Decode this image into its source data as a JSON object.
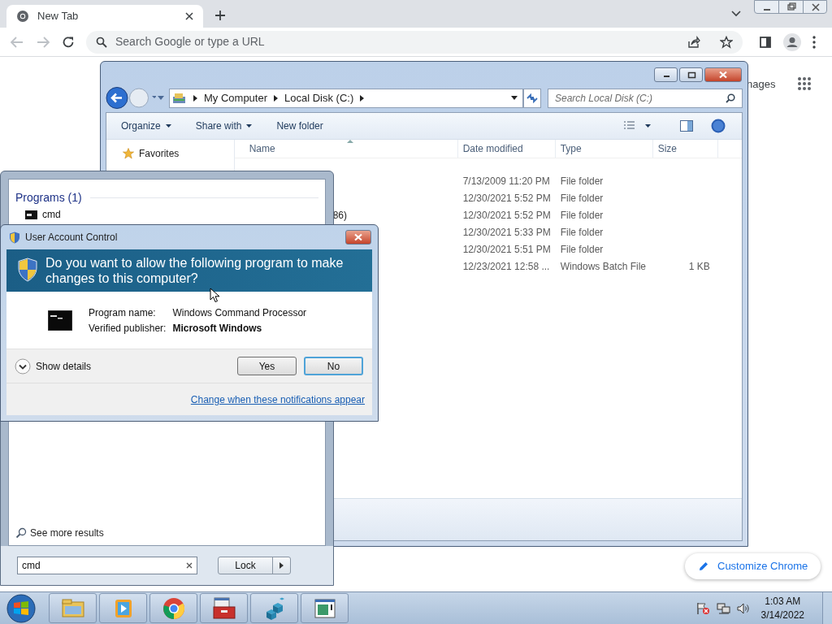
{
  "browser": {
    "tab": {
      "title": "New Tab",
      "selected": true
    },
    "address_placeholder": "Search Google or type a URL",
    "page": {
      "link_fragment": "nages",
      "customize_button": "Customize Chrome"
    }
  },
  "explorer": {
    "breadcrumb": [
      "My Computer",
      "Local Disk (C:)"
    ],
    "search_placeholder": "Search Local Disk (C:)",
    "toolbar": [
      {
        "label": "Organize",
        "dropdown": true
      },
      {
        "label": "Share with",
        "dropdown": true
      },
      {
        "label": "New folder",
        "dropdown": false
      }
    ],
    "nav": [
      {
        "label": "Favorites"
      }
    ],
    "columns": [
      "Name",
      "Date modified",
      "Type",
      "Size"
    ],
    "rows": [
      {
        "date": "7/13/2009 11:20 PM",
        "type": "File folder"
      },
      {
        "date": "12/30/2021 5:52 PM",
        "type": "File folder"
      },
      {
        "name": "86)",
        "date": "12/30/2021 5:52 PM",
        "type": "File folder"
      },
      {
        "date": "12/30/2021 5:33 PM",
        "type": "File folder"
      },
      {
        "date": "12/30/2021 5:51 PM",
        "type": "File folder"
      },
      {
        "date": "12/23/2021 12:58 ...",
        "type": "Windows Batch File",
        "size": "1 KB"
      }
    ]
  },
  "start_menu": {
    "section_title": "Programs (1)",
    "results": [
      {
        "label": "cmd"
      }
    ],
    "see_more": "See more results",
    "search_value": "cmd",
    "power_button": "Lock"
  },
  "uac": {
    "title": "User Account Control",
    "question": "Do you want to allow the following program to make changes to this computer?",
    "details": [
      {
        "label": "Program name:",
        "value": "Windows Command Processor",
        "bold": false
      },
      {
        "label": "Verified publisher:",
        "value": "Microsoft Windows",
        "bold": true
      }
    ],
    "show_details": "Show details",
    "buttons": [
      {
        "label": "Yes",
        "selected": false
      },
      {
        "label": "No",
        "selected": true
      }
    ],
    "link": "Change when these notifications appear"
  },
  "taskbar": {
    "items": [
      {
        "kind": "folder"
      },
      {
        "kind": "media"
      },
      {
        "kind": "chrome"
      },
      {
        "kind": "toolbox"
      },
      {
        "kind": "cubes"
      },
      {
        "kind": "window"
      }
    ],
    "time": "1:03 AM",
    "date": "3/14/2022"
  }
}
